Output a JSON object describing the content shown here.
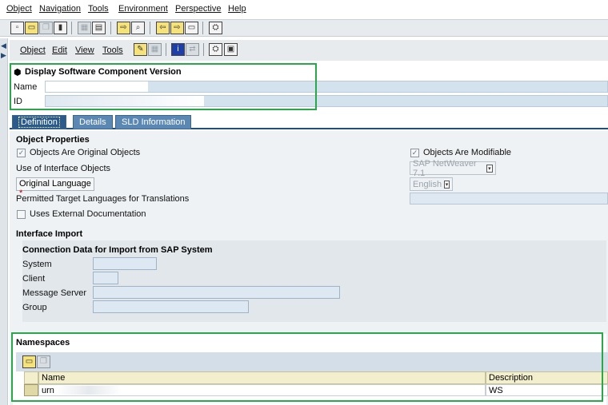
{
  "menu": [
    {
      "label": "Object",
      "accel": "O"
    },
    {
      "label": "Navigation",
      "accel": "N"
    },
    {
      "label": "Tools",
      "accel": "T"
    },
    {
      "label": "Environment",
      "accel": "E"
    },
    {
      "label": "Perspective",
      "accel": "P"
    },
    {
      "label": "Help",
      "accel": "H"
    }
  ],
  "submenu": [
    {
      "label": "Object"
    },
    {
      "label": "Edit"
    },
    {
      "label": "View"
    },
    {
      "label": "Tools"
    }
  ],
  "header": {
    "title": "Display Software Component Version",
    "name_label": "Name",
    "name_value": "",
    "id_label": "ID",
    "id_value": ""
  },
  "tabs": [
    {
      "label": "Definition",
      "active": true
    },
    {
      "label": "Details",
      "active": false
    },
    {
      "label": "SLD Information",
      "active": false
    }
  ],
  "object_properties": {
    "title": "Object Properties",
    "original_objects_label": "Objects Are Original Objects",
    "original_objects_checked": true,
    "modifiable_label": "Objects Are Modifiable",
    "modifiable_checked": true,
    "use_interface_label": "Use of Interface Objects",
    "use_interface_value": "SAP NetWeaver 7.1",
    "original_language_label": "Original Language",
    "required_marker": "*",
    "original_language_value": "English",
    "permitted_languages_label": "Permitted Target Languages for Translations",
    "permitted_languages_value": "",
    "external_doc_label": "Uses External Documentation",
    "external_doc_checked": false
  },
  "interface_import": {
    "title": "Interface Import",
    "connection_title": "Connection Data for Import from SAP System",
    "system_label": "System",
    "client_label": "Client",
    "message_server_label": "Message Server",
    "group_label": "Group"
  },
  "namespaces": {
    "title": "Namespaces",
    "columns": [
      "Name",
      "Description"
    ],
    "rows": [
      {
        "name": "urn",
        "description": "WS"
      }
    ]
  },
  "colors": {
    "highlight_box": "#29a84a",
    "tab_active": "#2a5b8a",
    "tab_inactive": "#5b87b3",
    "required": "#c00000"
  }
}
